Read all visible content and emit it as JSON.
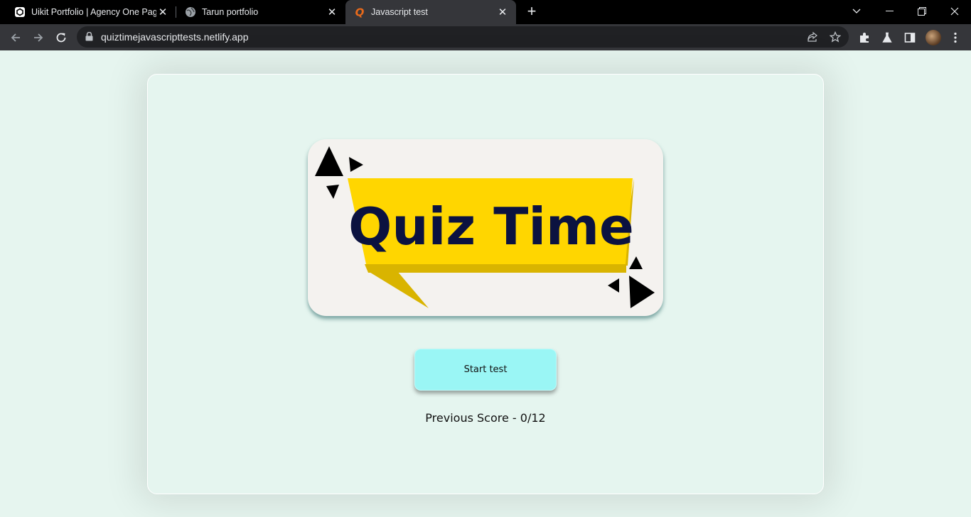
{
  "browser": {
    "tabs": [
      {
        "title": "Uikit Portfolio | Agency One Page",
        "favicon": "uikit-logo-icon"
      },
      {
        "title": "Tarun portfolio",
        "favicon": "globe-icon"
      },
      {
        "title": "Javascript test",
        "favicon": "quiz-q-icon",
        "active": true
      }
    ],
    "url": "quiztimejavascripttests.netlify.app",
    "accent": "#e86a1b"
  },
  "page": {
    "banner": {
      "title": "Quiz Time",
      "colors": {
        "ribbon": "#ffd600",
        "ribbon_shadow": "#d9b400",
        "text": "#0b1240",
        "shapes": "#000000"
      }
    },
    "start_button": "Start test",
    "score_text": "Previous Score - 0/12",
    "colors": {
      "background": "#e6f5ef",
      "button": "#9af6f5"
    }
  }
}
